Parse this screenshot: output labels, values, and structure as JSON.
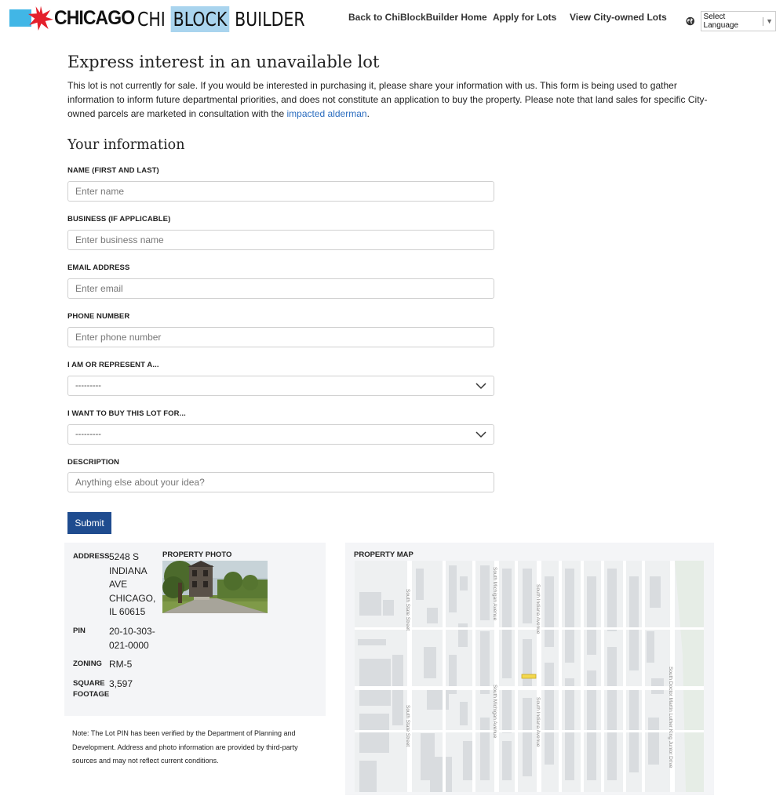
{
  "header": {
    "city_logo_text": "CHICAGO",
    "app_logo": {
      "part1": "CHI",
      "part2": "BLOCK",
      "part3": "BUILDER"
    },
    "nav": [
      {
        "label": "Back to ChiBlockBuilder Home"
      },
      {
        "label": "Apply for Lots"
      },
      {
        "label": "View City-owned Lots"
      }
    ],
    "language_select": {
      "label": "Select Language",
      "arrow": "▼"
    }
  },
  "page": {
    "title": "Express interest in an unavailable lot",
    "intro_text": "This lot is not currently for sale. If you would be interested in purchasing it, please share your information with us. This form is being used to gather information to inform future departmental priorities, and does not constitute an application to buy the property. Please note that land sales for specific City-owned parcels are marketed in consultation with the ",
    "intro_link": "impacted alderman",
    "intro_end": ".",
    "section_title": "Your information"
  },
  "form": {
    "name": {
      "label": "NAME (FIRST AND LAST)",
      "placeholder": "Enter name",
      "value": ""
    },
    "business": {
      "label": "BUSINESS (IF APPLICABLE)",
      "placeholder": "Enter business name",
      "value": ""
    },
    "email": {
      "label": "EMAIL ADDRESS",
      "placeholder": "Enter email",
      "value": ""
    },
    "phone": {
      "label": "PHONE NUMBER",
      "placeholder": "Enter phone number",
      "value": ""
    },
    "represent": {
      "label": "I AM OR REPRESENT A...",
      "selected": "---------"
    },
    "purpose": {
      "label": "I WANT TO BUY THIS LOT FOR...",
      "selected": "---------"
    },
    "description": {
      "label": "DESCRIPTION",
      "placeholder": "Anything else about your idea?",
      "value": ""
    },
    "submit_label": "Submit"
  },
  "property": {
    "address_label": "ADDRESS",
    "address_lines": [
      "5248 S",
      "INDIANA",
      "AVE",
      "CHICAGO,",
      "IL 60615"
    ],
    "pin_label": "PIN",
    "pin_lines": [
      "20-10-303-",
      "021-0000"
    ],
    "zoning_label": "ZONING",
    "zoning": "RM-5",
    "sqft_label_lines": [
      "SQUARE",
      "FOOTAGE"
    ],
    "sqft": "3,597",
    "photo_label": "PROPERTY PHOTO",
    "note": "Note: The Lot PIN has been verified by the Department of Planning and Development. Address and photo information are provided by third-party sources and may not reflect current conditions."
  },
  "map": {
    "label": "PROPERTY MAP",
    "streets": [
      "South State Street",
      "South Michigan Avenue",
      "South Indiana Avenue",
      "South Doctor Martin Luther King Junior Drive"
    ],
    "colors": {
      "land": "#eef0f1",
      "road": "#ffffff",
      "building": "#d9dcdf",
      "highlight": "#f3d84e",
      "park": "#e6ede6"
    }
  },
  "colors": {
    "accent": "#1f4c8f",
    "link": "#2a6cbf",
    "panel": "#f4f5f7",
    "flag_blue": "#41b6e6",
    "flag_red": "#e4202c",
    "block_bg": "#a9d4ee"
  }
}
